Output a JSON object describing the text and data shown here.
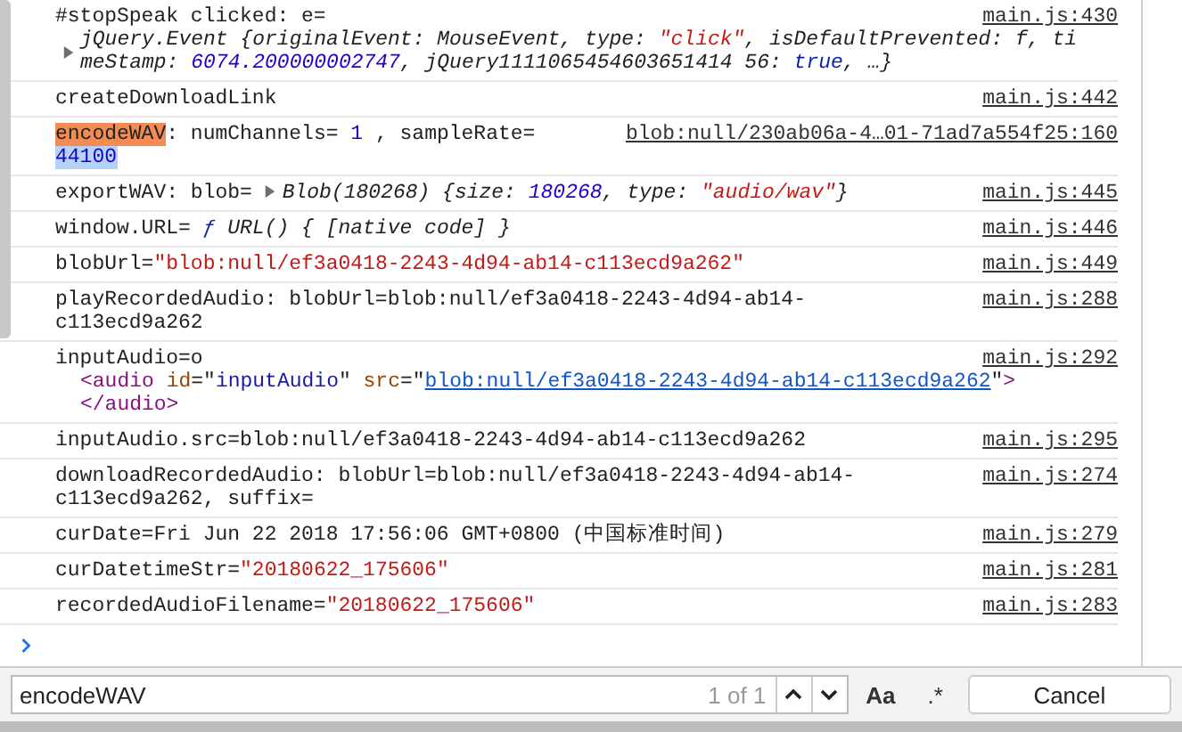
{
  "messages": [
    {
      "lines": [
        [
          {
            "t": "#stopSpeak clicked: e=",
            "kind": "plain"
          }
        ]
      ],
      "preview": {
        "expanded": false,
        "lines": [
          [
            {
              "t": "jQuery.Event {originalEvent: MouseEvent, type: ",
              "kind": "plain",
              "italic": true
            },
            {
              "t": "\"click\"",
              "kind": "string",
              "italic": true
            },
            {
              "t": ", isDefaultPrevented: f, ti",
              "kind": "plain",
              "italic": true
            }
          ],
          [
            {
              "t": "meStamp: ",
              "kind": "plain",
              "italic": true
            },
            {
              "t": "6074.200000002747",
              "kind": "number",
              "italic": true
            },
            {
              "t": ", jQuery1111065454603651414 56: ",
              "kind": "plain",
              "italic": true
            },
            {
              "t": "true",
              "kind": "keyword",
              "italic": true
            },
            {
              "t": ", …}",
              "kind": "plain",
              "italic": true
            }
          ]
        ]
      },
      "source": "main.js:430"
    },
    {
      "lines": [
        [
          {
            "t": "createDownloadLink",
            "kind": "plain"
          }
        ]
      ],
      "source": "main.js:442"
    },
    {
      "lines": [
        [
          {
            "t": "encodeWAV",
            "kind": "match"
          },
          {
            "t": ": numChannels= ",
            "kind": "plain"
          },
          {
            "t": "1",
            "kind": "number"
          },
          {
            "t": " , sampleRate=",
            "kind": "plain"
          }
        ],
        [
          {
            "t": "44100",
            "kind": "selection"
          }
        ]
      ],
      "source": "blob:null/230ab06a-4…01-71ad7a554f25:160"
    },
    {
      "lines": [
        [
          {
            "t": "exportWAV: blob= ",
            "kind": "plain"
          },
          {
            "kind": "expander",
            "expanded": false
          },
          {
            "t": "Blob(180268) {size: ",
            "kind": "plain",
            "italic": true
          },
          {
            "t": "180268",
            "kind": "number",
            "italic": true
          },
          {
            "t": ", type: ",
            "kind": "plain",
            "italic": true
          },
          {
            "t": "\"audio/wav\"",
            "kind": "string",
            "italic": true
          },
          {
            "t": "}",
            "kind": "plain",
            "italic": true
          }
        ]
      ],
      "source": "main.js:445"
    },
    {
      "lines": [
        [
          {
            "t": "window.URL= ",
            "kind": "plain"
          },
          {
            "t": "ƒ",
            "kind": "keyword",
            "italic": true
          },
          {
            "t": " URL() { [native code] }",
            "kind": "plain",
            "italic": true
          }
        ]
      ],
      "source": "main.js:446"
    },
    {
      "lines": [
        [
          {
            "t": "blobUrl=",
            "kind": "plain"
          },
          {
            "t": "\"blob:null/ef3a0418-2243-4d94-ab14-c113ecd9a262\"",
            "kind": "string"
          }
        ]
      ],
      "source": "main.js:449"
    },
    {
      "lines": [
        [
          {
            "t": "playRecordedAudio: blobUrl=blob:null/ef3a0418-2243-4d94-ab14-",
            "kind": "plain"
          }
        ],
        [
          {
            "t": "c113ecd9a262",
            "kind": "plain"
          }
        ]
      ],
      "source": "main.js:288"
    },
    {
      "lines": [
        [
          {
            "t": "inputAudio=o",
            "kind": "plain"
          }
        ]
      ],
      "element": [
        [
          {
            "t": "<audio",
            "kind": "tag"
          },
          {
            "t": " id",
            "kind": "attribute"
          },
          {
            "t": "=\"",
            "kind": "plain"
          },
          {
            "t": "inputAudio",
            "kind": "value"
          },
          {
            "t": "\"",
            "kind": "plain"
          },
          {
            "t": " src",
            "kind": "attribute"
          },
          {
            "t": "=\"",
            "kind": "plain"
          },
          {
            "t": "blob:null/ef3a0418-2243-4d94-ab14-c113ecd9a262",
            "kind": "link"
          },
          {
            "t": "\"",
            "kind": "plain"
          },
          {
            "t": ">",
            "kind": "tag"
          }
        ],
        [
          {
            "t": "</audio>",
            "kind": "tag"
          }
        ]
      ],
      "source": "main.js:292"
    },
    {
      "lines": [
        [
          {
            "t": "inputAudio.src=blob:null/ef3a0418-2243-4d94-ab14-c113ecd9a262",
            "kind": "plain"
          }
        ]
      ],
      "source": "main.js:295"
    },
    {
      "lines": [
        [
          {
            "t": "downloadRecordedAudio: blobUrl=blob:null/ef3a0418-2243-4d94-ab14-",
            "kind": "plain"
          }
        ],
        [
          {
            "t": "c113ecd9a262, suffix=",
            "kind": "plain"
          }
        ]
      ],
      "source": "main.js:274"
    },
    {
      "lines": [
        [
          {
            "t": "curDate=Fri Jun 22 2018 17:56:06 GMT+0800 (中国标准时间)",
            "kind": "plain"
          }
        ]
      ],
      "source": "main.js:279"
    },
    {
      "lines": [
        [
          {
            "t": "curDatetimeStr=",
            "kind": "plain"
          },
          {
            "t": "\"20180622_175606\"",
            "kind": "string"
          }
        ]
      ],
      "source": "main.js:281"
    },
    {
      "lines": [
        [
          {
            "t": "recordedAudioFilename=",
            "kind": "plain"
          },
          {
            "t": "\"20180622_175606\"",
            "kind": "string"
          }
        ]
      ],
      "source": "main.js:283"
    }
  ],
  "search": {
    "value": "encodeWAV",
    "count": "1 of 1",
    "case_button": "Aa",
    "regex_button": ".*",
    "cancel_button": "Cancel"
  }
}
